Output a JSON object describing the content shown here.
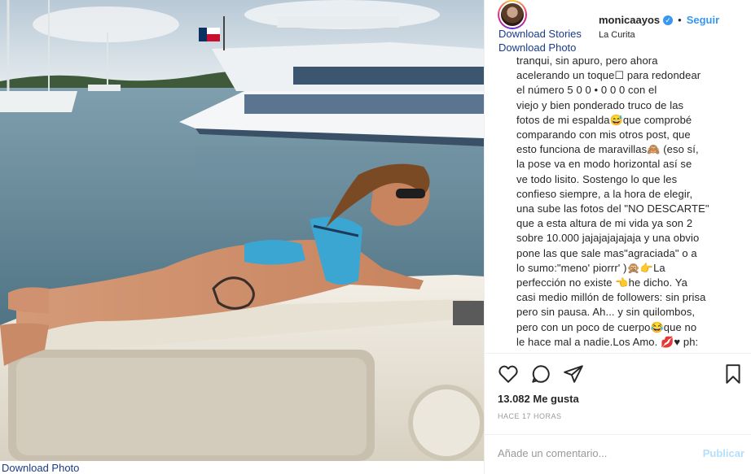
{
  "download": {
    "stories": "Download Stories",
    "photo_header": "Download Photo",
    "photo_bottom": "Download Photo"
  },
  "post": {
    "username": "monicaayos",
    "separator": "•",
    "follow_label": "Seguir",
    "location": "La Curita",
    "caption_lines": [
      "tranqui, sin apuro, pero ahora",
      "acelerando un toque☐ para redondear",
      "el número 5 0 0 • 0 0 0 con el",
      "viejo y bien ponderado truco de las",
      "fotos de mi espalda😅que comprobé",
      "comparando con mis otros post, que",
      "esto funciona de maravillas🙈 (eso sí,",
      "la pose va en modo horizontal así se",
      "ve todo lisito. Sostengo lo que les",
      "confieso siempre, a la hora de elegir,",
      "una sube las fotos del \"NO DESCARTE\"",
      "que a esta altura de mi vida ya son 2",
      "sobre 10.000 jajajajajajaja y una obvio",
      "pone las que sale mas\"agraciada\" o a",
      "lo sumo:\"meno' piorrr' )🙊👉La",
      "perfección no existe 👈he dicho. Ya",
      "casi medio millón de followers: sin prisa",
      "pero sin pausa. Ah... y sin quilombos,",
      "pero con un poco de cuerpo😂que no",
      "le hace mal a nadie.Los Amo. 💋♥ ph:"
    ],
    "likes": "13.082 Me gusta",
    "time": "HACE 17 HORAS",
    "comment_placeholder": "Añade un comentario...",
    "publish_label": "Publicar"
  },
  "icons": {
    "like": "heart-icon",
    "comment": "comment-bubble-icon",
    "share": "paper-plane-icon",
    "save": "bookmark-icon",
    "verified": "verified-badge-icon"
  },
  "colors": {
    "link_blue": "#3897f0",
    "download_link": "#1a3a8a",
    "text": "#262626",
    "muted": "#999999"
  }
}
